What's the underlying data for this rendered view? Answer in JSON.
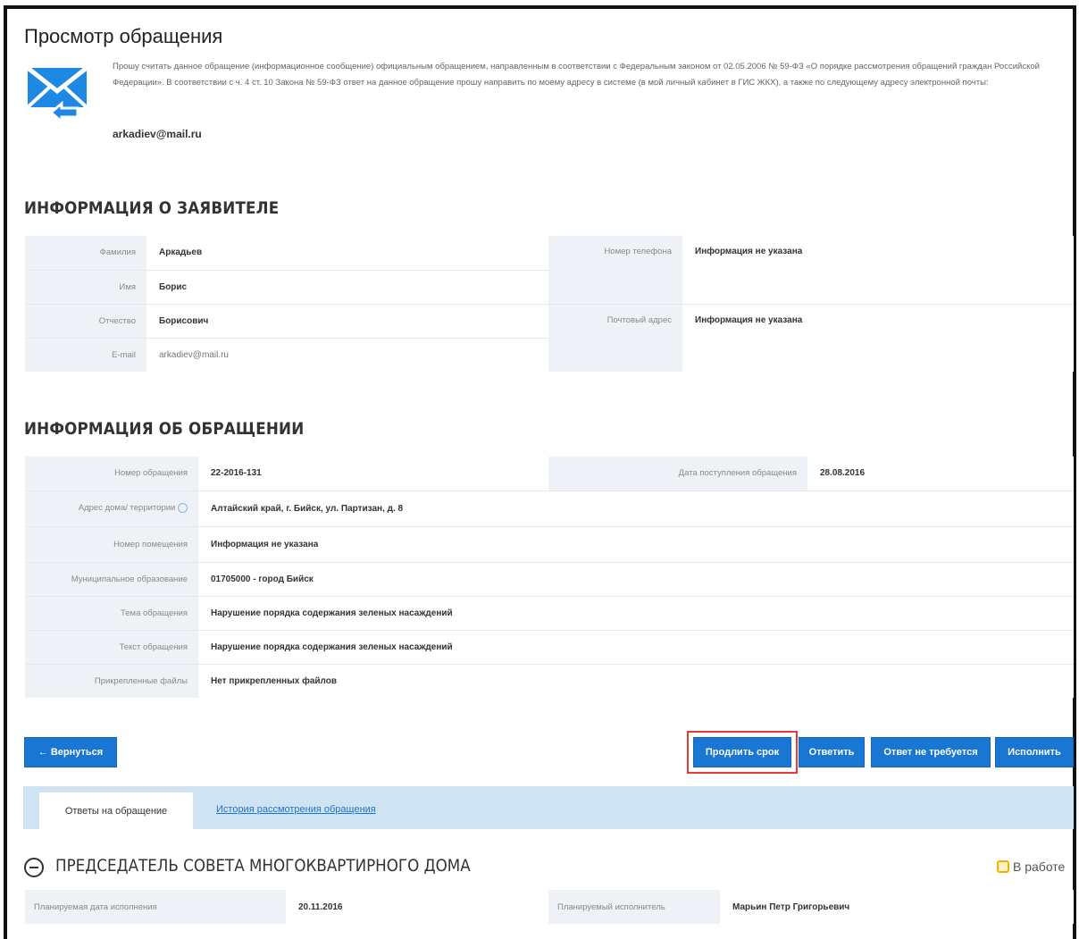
{
  "page": {
    "title": "Просмотр обращения",
    "notice": "Прошу считать данное обращение (информационное сообщение) официальным обращением, направленным в соответствии с Федеральным законом от 02.05.2006 № 59-ФЗ «О порядке рассмотрения обращений граждан Российской Федерации». В соответствии с ч. 4 ст. 10 Закона № 59-ФЗ ответ на данное обращение прошу направить по моему адресу в системе (в мой личный кабинет в ГИС ЖКХ), а также по следующему адресу электронной почты:",
    "email": "arkadiev@mail.ru",
    "mail_icon": "envelope-reply-icon"
  },
  "applicant": {
    "section_title": "ИНФОРМАЦИЯ О ЗАЯВИТЕЛЕ",
    "left": [
      {
        "label": "Фамилия",
        "value": "Аркадьев"
      },
      {
        "label": "Имя",
        "value": "Борис"
      },
      {
        "label": "Отчество",
        "value": "Борисович"
      },
      {
        "label": "E-mail",
        "value": "arkadiev@mail.ru"
      }
    ],
    "right": [
      {
        "label": "Номер телефона",
        "value": "Информация не указана"
      },
      {
        "label": "Почтовый адрес",
        "value": "Информация не указана"
      }
    ]
  },
  "appeal": {
    "section_title": "ИНФОРМАЦИЯ ОБ ОБРАЩЕНИИ",
    "number_label": "Номер обращения",
    "number_value": "22-2016-131",
    "date_label": "Дата поступления обращения",
    "date_value": "28.08.2016",
    "rows": [
      {
        "label": "Адрес дома/ территории",
        "value": "Алтайский край, г. Бийск, ул. Партизан, д. 8"
      },
      {
        "label": "Номер помещения",
        "value": "Информация не указана"
      },
      {
        "label": "Муниципальное образование",
        "value": "01705000 - город Бийск"
      },
      {
        "label": "Тема обращения",
        "value": "Нарушение порядка содержания зеленых насаждений"
      },
      {
        "label": "Текст обращения",
        "value": "Нарушение порядка содержания зеленых насаждений"
      },
      {
        "label": "Прикрепленные файлы",
        "value": "Нет прикрепленных файлов"
      }
    ]
  },
  "buttons": {
    "back": "← Вернуться",
    "extend": "Продлить срок",
    "reply": "Ответить",
    "no_reply": "Ответ не требуется",
    "execute": "Исполнить"
  },
  "tabs": {
    "active": "Ответы на обращение",
    "history": "История рассмотрения обращения"
  },
  "chair": {
    "title": "ПРЕДСЕДАТЕЛЬ СОВЕТА МНОГОКВАРТИРНОГО ДОМА",
    "status": "В работе",
    "planned_date_label": "Планируемая дата исполнения",
    "planned_date_value": "20.11.2016",
    "executor_label": "Планируемый исполнитель",
    "executor_value": "Марьин Петр Григорьевич"
  },
  "colors": {
    "accent": "#1976d2",
    "label_bg": "#eef2f6",
    "tabs_bg": "#cfe3f3",
    "highlight": "#e53935"
  }
}
